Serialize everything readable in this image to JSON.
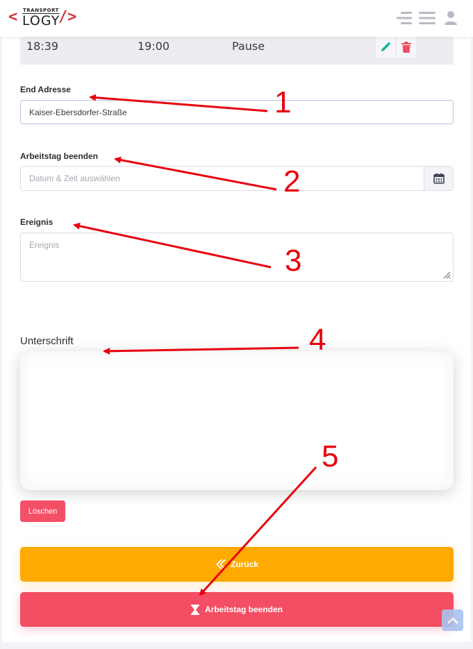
{
  "brand": {
    "logo_left": "<",
    "logo_small": "TRANSPORT",
    "logo_big": "LOGY",
    "logo_right": "/>"
  },
  "header": {
    "icons": [
      "menu-collapse-icon",
      "hamburger-menu-icon",
      "user-icon"
    ]
  },
  "pause_row": {
    "start": "18:39",
    "end": "19:00",
    "type": "Pause",
    "actions": [
      "edit-icon",
      "delete-icon"
    ]
  },
  "form": {
    "end_address": {
      "label": "End Adresse",
      "value": "Kaiser-Ebersdorfer-Straße"
    },
    "end_workday": {
      "label": "Arbeitstag beenden",
      "placeholder": "Datum & Zeit auswählen"
    },
    "event": {
      "label": "Ereignis",
      "placeholder": "Ereignis"
    },
    "signature": {
      "label": "Unterschrift"
    }
  },
  "buttons": {
    "delete": "Löschen",
    "back": "Zurück",
    "end_workday": "Arbeitstag beenden"
  },
  "annotations": [
    "1",
    "2",
    "3",
    "4",
    "5"
  ],
  "colors": {
    "brand_red": "#d6313a",
    "back_button": "#ffaa00",
    "end_button": "#f34e63",
    "delete_button": "#f35068",
    "annotation_red": "#e8000d",
    "edit_icon": "#19b39a"
  }
}
